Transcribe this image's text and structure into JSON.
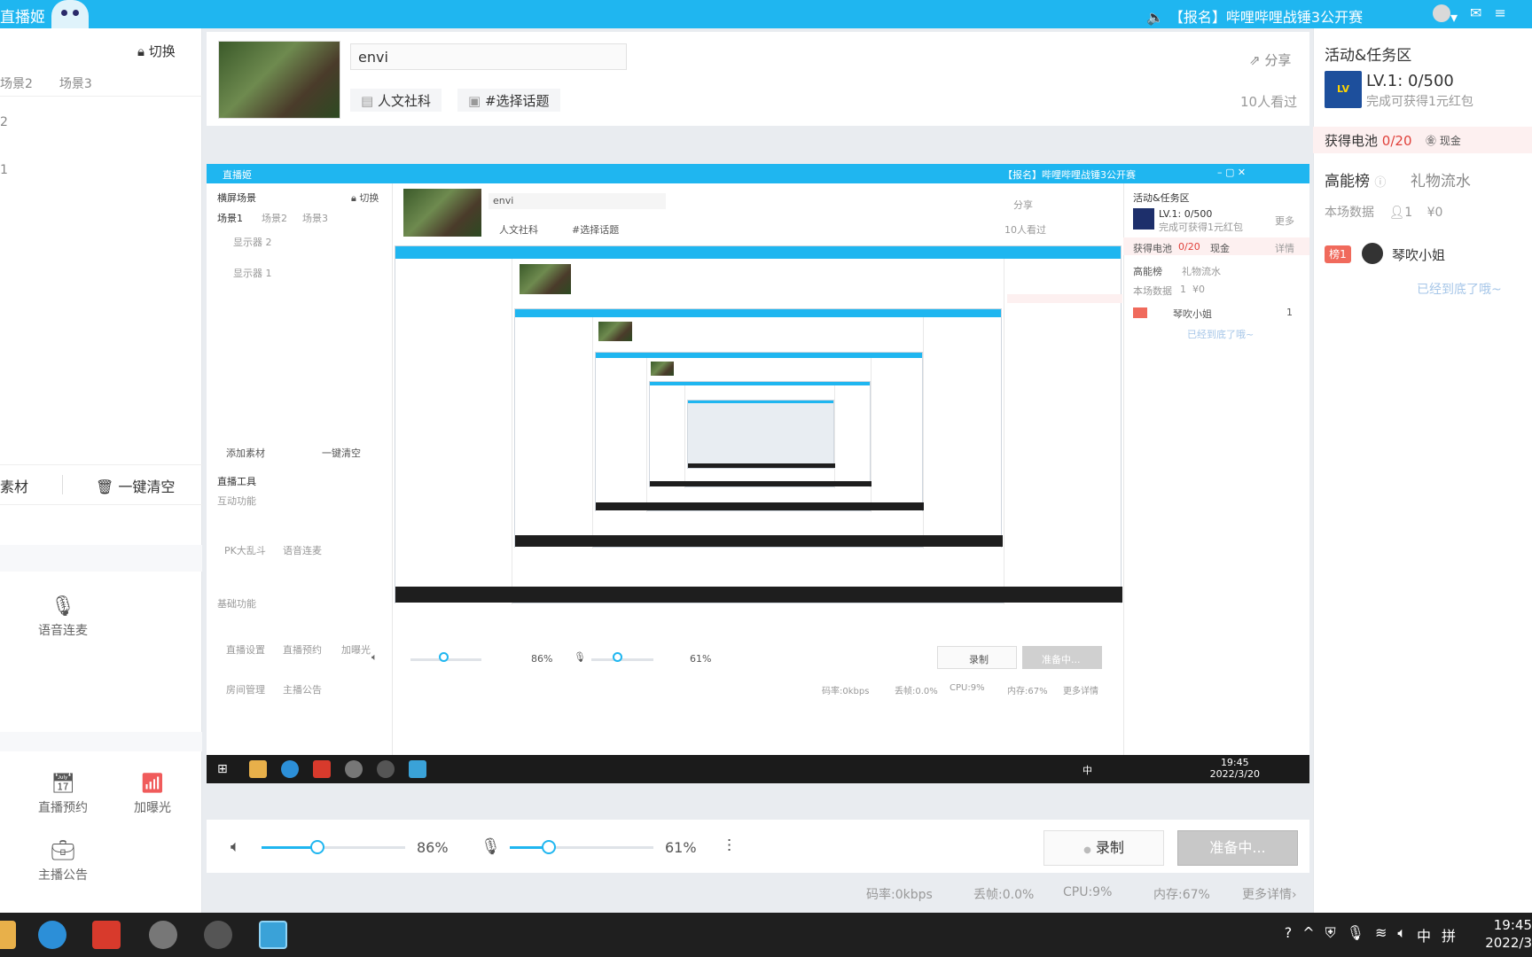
{
  "titlebar": {
    "app_title": "直播姬",
    "notice": "【报名】哔哩哔哩战锤3公开赛"
  },
  "left": {
    "switch_label": "切换",
    "scene_tabs": [
      "场景2",
      "场景3"
    ],
    "display_items": [
      "2",
      "1"
    ],
    "material_label": "素材",
    "clear_label": "一键清空",
    "tools": {
      "voice_link": "语音连麦",
      "live_schedule": "直播预约",
      "boost": "加曝光",
      "announcement": "主播公告"
    }
  },
  "header": {
    "title_value": "envi",
    "category_tag": "人文社科",
    "topic_tag": "#选择话题",
    "share_label": "分享",
    "viewers": "10人看过"
  },
  "preview": {
    "titlebar_notice": "【报名】哔哩哔哩战锤3公开赛",
    "scene_header": "横屏场景",
    "switch_label": "切换",
    "scene_tabs": [
      "场景1",
      "场景2",
      "场景3"
    ],
    "displays": [
      "显示器 2",
      "显示器 1"
    ],
    "add_material": "添加素材",
    "clear": "一键清空",
    "tools_title": "直播工具",
    "interactive": "互动功能",
    "pk": "PK大乱斗",
    "voice": "语音连麦",
    "basic": "基础功能",
    "live_settings": "直播设置",
    "live_schedule": "直播预约",
    "boost": "加曝光",
    "room_manage": "房间管理",
    "announcement": "主播公告",
    "title_value": "envi",
    "category_tag": "人文社科",
    "topic_tag": "#选择话题",
    "share_label": "分享",
    "viewers": "10人看过",
    "activity_title": "活动&任务区",
    "lv": "LV.1:  0/500",
    "lv_sub": "完成可获得1元红包",
    "more": "更多",
    "battery": "获得电池",
    "battery_val": "0/20",
    "cash": "现金",
    "detail": "详情",
    "rank_tab": "高能榜",
    "gift_tab": "礼物流水",
    "session_data": "本场数据",
    "session_count": "1",
    "session_money": "¥0",
    "rank_name": "琴吹小姐",
    "rank_val": "1",
    "bottom_note": "已经到底了哦~",
    "vol_pct": "86%",
    "mic_pct": "61%",
    "record": "录制",
    "ready": "准备中...",
    "bitrate": "码率:0kbps",
    "dropped": "丢帧:0.0%",
    "cpu": "CPU:9%",
    "mem": "内存:67%",
    "more_details": "更多详情",
    "clock_time": "19:45",
    "clock_date": "2022/3/20",
    "ime": "中"
  },
  "controls": {
    "volume_value": 0.86,
    "volume_pct": "86%",
    "mic_value": 0.61,
    "mic_pct": "61%",
    "record_label": "录制",
    "ready_label": "准备中..."
  },
  "stats": {
    "bitrate": "码率:0kbps",
    "dropped": "丢帧:0.0%",
    "cpu": "CPU:9%",
    "mem": "内存:67%",
    "more": "更多详情"
  },
  "right": {
    "activity_title": "活动&任务区",
    "lv_text": "LV.1:   0/500",
    "lv_sub": "完成可获得1元红包",
    "battery_label": "获得电池",
    "battery_value": "0/20",
    "cash_label": "现金",
    "rank_tab": "高能榜",
    "gift_tab": "礼物流水",
    "session_data": "本场数据",
    "session_count": "1",
    "session_money": "¥0",
    "rank_badge": "榜1",
    "rank_name": "琴吹小姐",
    "bottom_note": "已经到底了哦~"
  },
  "taskbar": {
    "ime": "中",
    "ime2": "拼",
    "clock_time": "19:45",
    "clock_date": "2022/3"
  },
  "colors": {
    "accent": "#1fb6f0",
    "ready_gray": "#c8c8c8",
    "red": "#e0403a"
  }
}
